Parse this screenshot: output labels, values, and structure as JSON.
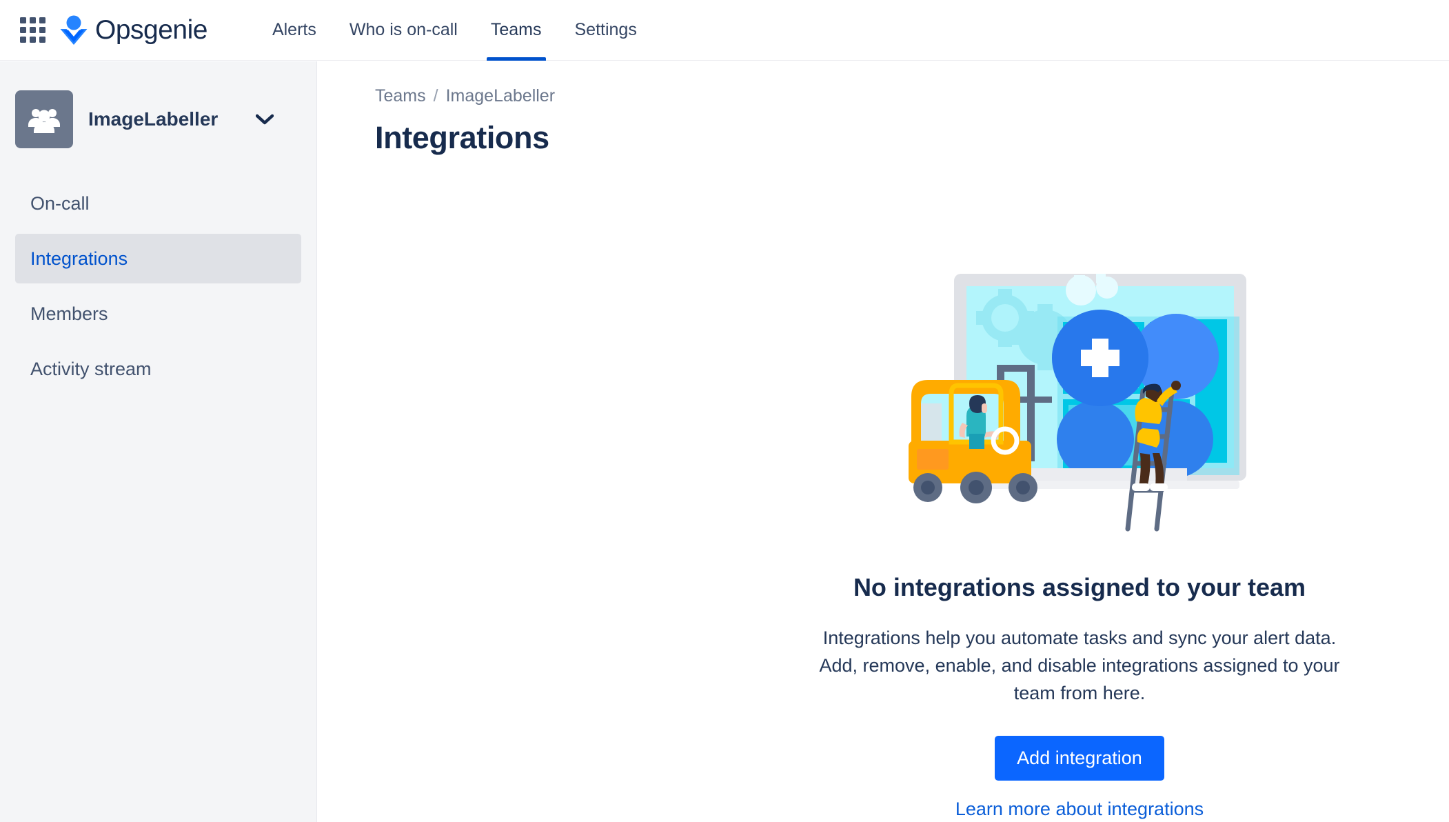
{
  "topnav": {
    "app_switcher_icon": "grid-apps-icon",
    "logo_icon": "opsgenie-logo-icon",
    "brand": "Opsgenie",
    "links": [
      {
        "label": "Alerts",
        "active": false
      },
      {
        "label": "Who is on-call",
        "active": false
      },
      {
        "label": "Teams",
        "active": true
      },
      {
        "label": "Settings",
        "active": false
      }
    ],
    "active_tab": "Teams",
    "accent_color": "#0052CC"
  },
  "sidebar": {
    "team_name": "ImageLabeller",
    "team_avatar_icon": "people-group-icon",
    "chevron_icon": "chevron-down-icon",
    "items": [
      {
        "label": "On-call",
        "selected": false
      },
      {
        "label": "Integrations",
        "selected": true
      },
      {
        "label": "Members",
        "selected": false
      },
      {
        "label": "Activity stream",
        "selected": false
      }
    ],
    "selected_item": "Integrations",
    "selected_bg": "#DFE1E6",
    "selected_color": "#0052CC"
  },
  "main": {
    "breadcrumb": {
      "parent": "Teams",
      "separator": "/",
      "current": "ImageLabeller"
    },
    "page_title": "Integrations",
    "empty_state": {
      "illustration_name": "integrations-empty-illustration",
      "title": "No integrations assigned to your team",
      "body": "Integrations help you automate tasks and sync your alert data. Add, remove, enable, and disable integrations assigned to your team from here.",
      "primary_button": "Add integration",
      "link": "Learn more about integrations",
      "button_color": "#0B66FF",
      "link_color": "#0B5ED8"
    }
  }
}
